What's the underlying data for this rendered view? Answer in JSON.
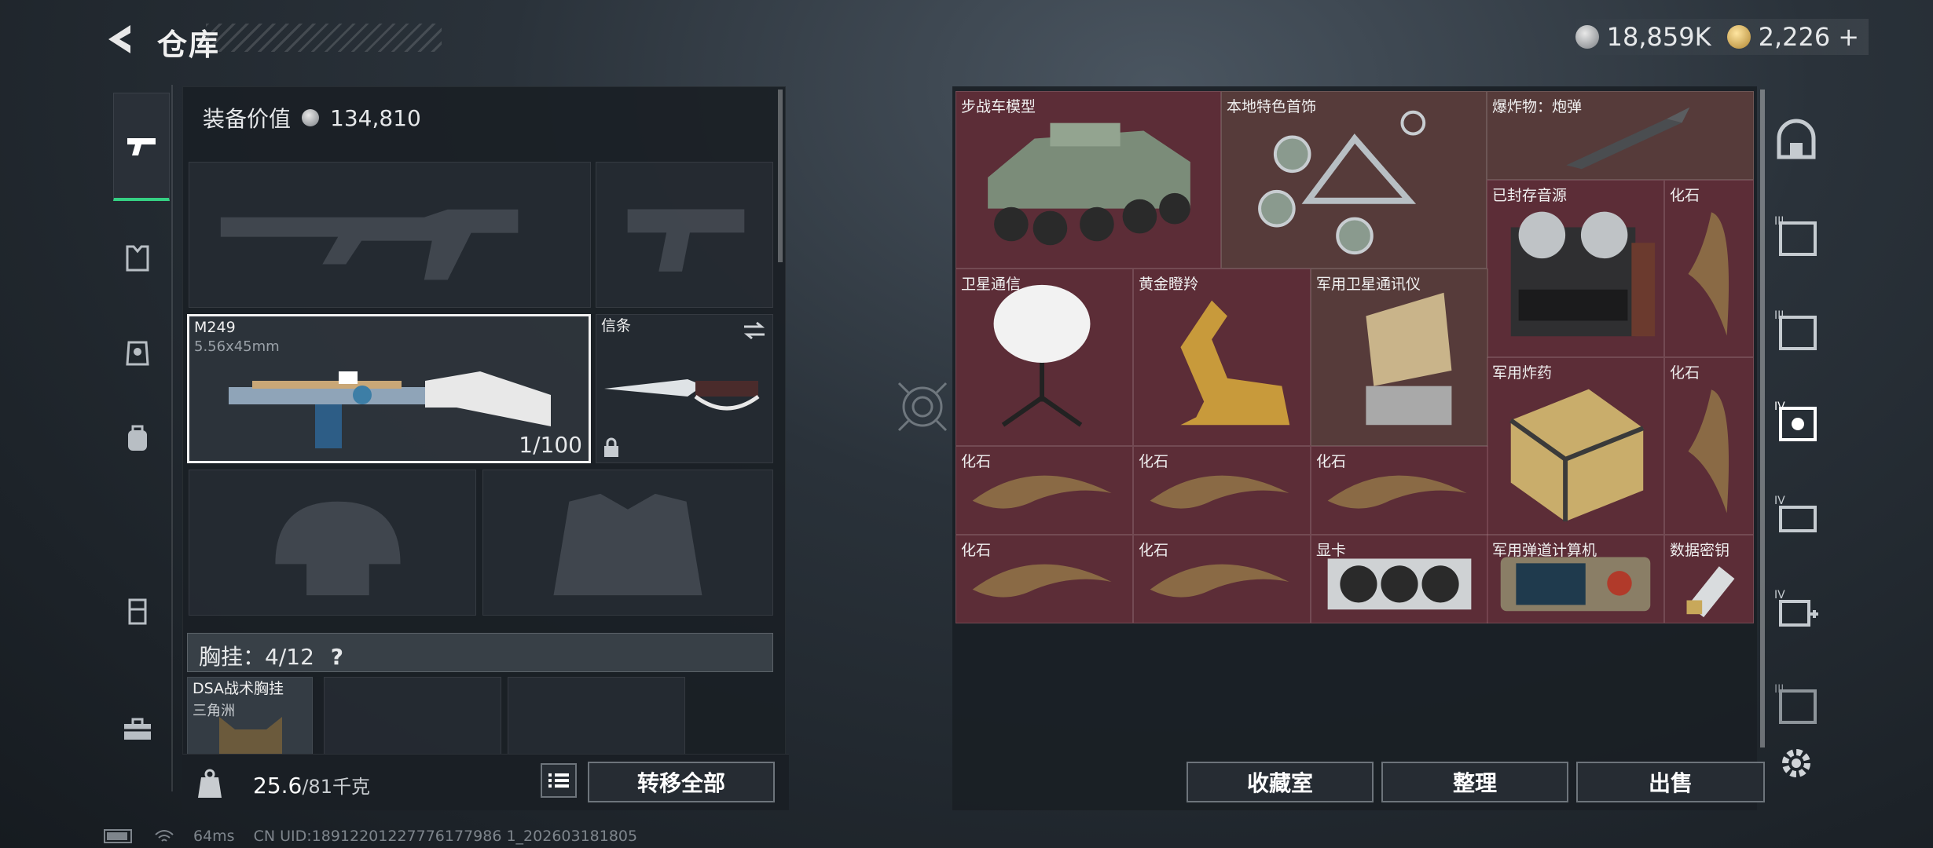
{
  "header": {
    "title": "仓库",
    "back_icon": "back-arrow-icon"
  },
  "currency": {
    "silver": "18,859K",
    "gold": "2,226",
    "gold_plus": "+"
  },
  "left": {
    "equip_label": "装备价值",
    "equip_value": "134,810",
    "primary_weapon": {
      "name": "M249",
      "ammo": "5.56x45mm",
      "durability": "1/100"
    },
    "melee": {
      "name": "信条"
    },
    "vest_label": "胸挂：4/12",
    "vest_help": "?",
    "vest_item": {
      "name": "DSA战术胸挂",
      "sub": "三角洲"
    },
    "weight": "25.6",
    "weight_max": "/81千克",
    "transfer_all": "转移全部"
  },
  "grid": {
    "items": [
      {
        "name": "步战车模型",
        "icon": "armored-vehicle"
      },
      {
        "name": "本地特色首饰",
        "icon": "jewelry"
      },
      {
        "name": "爆炸物：炮弹",
        "icon": "shell"
      },
      {
        "name": "已封存音源",
        "icon": "tape-recorder"
      },
      {
        "name": "化石",
        "icon": "fossil-claw"
      },
      {
        "name": "卫星通信",
        "icon": "satellite-dish"
      },
      {
        "name": "黄金瞪羚",
        "icon": "golden-gazelle"
      },
      {
        "name": "军用卫星通讯仪",
        "icon": "sat-comm"
      },
      {
        "name": "军用炸药",
        "icon": "explosive"
      },
      {
        "name": "化石",
        "icon": "fossil-claw"
      },
      {
        "name": "化石",
        "icon": "fossil-claw"
      },
      {
        "name": "化石",
        "icon": "fossil-claw"
      },
      {
        "name": "化石",
        "icon": "fossil-claw"
      },
      {
        "name": "化石",
        "icon": "fossil-claw"
      },
      {
        "name": "化石",
        "icon": "fossil-claw"
      },
      {
        "name": "显卡",
        "icon": "graphics-card"
      },
      {
        "name": "军用弹道计算机",
        "icon": "ballistic-computer"
      },
      {
        "name": "数据密钥",
        "icon": "data-key"
      }
    ]
  },
  "buttons": {
    "collection": "收藏室",
    "sort": "整理",
    "sell": "出售"
  },
  "status": {
    "ping": "64ms",
    "uid": "CN UID:18912201227776177986 1_202603181805"
  }
}
